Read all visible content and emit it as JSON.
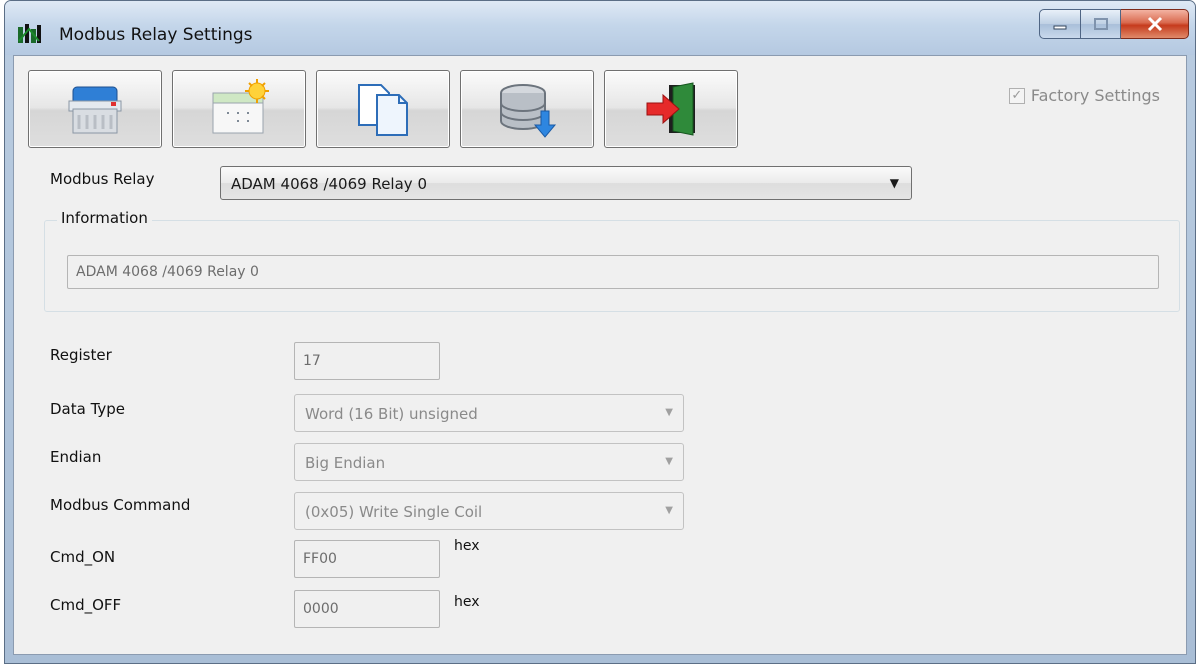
{
  "window": {
    "title": "Modbus Relay Settings"
  },
  "toolbar": {
    "buttons": [
      {
        "icon": "printer-icon"
      },
      {
        "icon": "new-settings-icon"
      },
      {
        "icon": "copy-icon"
      },
      {
        "icon": "database-save-icon"
      },
      {
        "icon": "exit-door-icon"
      }
    ]
  },
  "factory_settings": {
    "label": "Factory Settings",
    "checked": true,
    "check_glyph": "✓"
  },
  "modbus_relay": {
    "label": "Modbus Relay",
    "value": "ADAM 4068 /4069 Relay 0",
    "arrow": "▼"
  },
  "information": {
    "legend": "Information",
    "value": "ADAM 4068 /4069 Relay  0"
  },
  "form": {
    "register": {
      "label": "Register",
      "value": "17"
    },
    "data_type": {
      "label": "Data Type",
      "value": "Word (16 Bit)  unsigned"
    },
    "endian": {
      "label": "Endian",
      "value": "Big  Endian"
    },
    "modbus_command": {
      "label": "Modbus Command",
      "value": "(0x05) Write Single Coil"
    },
    "cmd_on": {
      "label": "Cmd_ON",
      "value": "FF00",
      "unit": "hex"
    },
    "cmd_off": {
      "label": "Cmd_OFF",
      "value": "0000",
      "unit": "hex"
    },
    "combo_arrow": "▼"
  }
}
